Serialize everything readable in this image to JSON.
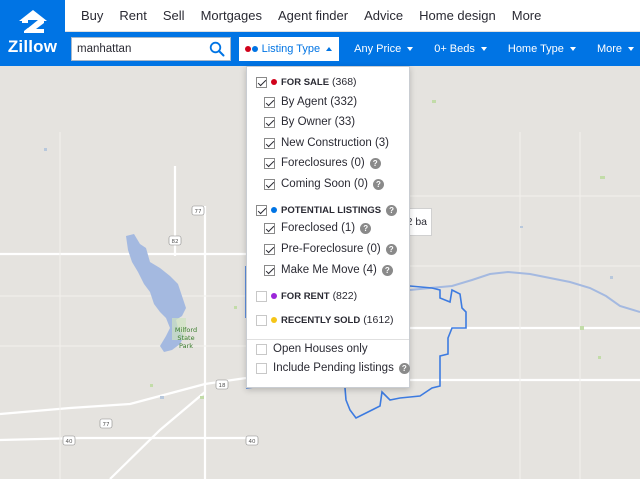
{
  "brand": {
    "logo_text": "Zillow"
  },
  "nav": {
    "items": [
      "Buy",
      "Rent",
      "Sell",
      "Mortgages",
      "Agent finder",
      "Advice",
      "Home design",
      "More"
    ]
  },
  "search": {
    "value": "manhattan"
  },
  "filters": {
    "listing_type": "Listing Type",
    "price": "Any Price",
    "beds": "0+ Beds",
    "home_type": "Home Type",
    "more": "More"
  },
  "dropdown": {
    "for_sale": {
      "label": "FOR SALE",
      "count": "(368)",
      "checked": true,
      "dot_color": "#d0021b"
    },
    "for_sale_items": [
      {
        "label": "By Agent (332)",
        "checked": true,
        "help": false
      },
      {
        "label": "By Owner (33)",
        "checked": true,
        "help": false
      },
      {
        "label": "New Construction (3)",
        "checked": true,
        "help": false
      },
      {
        "label": "Foreclosures (0)",
        "checked": true,
        "help": true
      },
      {
        "label": "Coming Soon (0)",
        "checked": true,
        "help": true
      }
    ],
    "potential": {
      "label": "POTENTIAL LISTINGS",
      "checked": true,
      "help": true,
      "dot_color": "#0074e4"
    },
    "potential_items": [
      {
        "label": "Foreclosed (1)",
        "checked": true,
        "help": true
      },
      {
        "label": "Pre-Foreclosure (0)",
        "checked": true,
        "help": true
      },
      {
        "label": "Make Me Move (4)",
        "checked": true,
        "help": true
      }
    ],
    "for_rent": {
      "label": "FOR RENT",
      "count": "(822)",
      "checked": false,
      "dot_color": "#9b27d9"
    },
    "recently_sold": {
      "label": "RECENTLY SOLD",
      "count": "(1612)",
      "checked": false,
      "dot_color": "#f5c518"
    },
    "open_houses": {
      "label": "Open Houses only",
      "checked": false
    },
    "pending": {
      "label": "Include Pending listings",
      "checked": false,
      "help": true
    }
  },
  "map": {
    "popup_text": "2 ba",
    "park_label": [
      "Milford",
      "State",
      "Park"
    ],
    "road_shields": [
      "77",
      "82",
      "18",
      "77",
      "40",
      "40"
    ],
    "boundary_color": "#3d7be0",
    "water_color": "#a4b9e0"
  }
}
